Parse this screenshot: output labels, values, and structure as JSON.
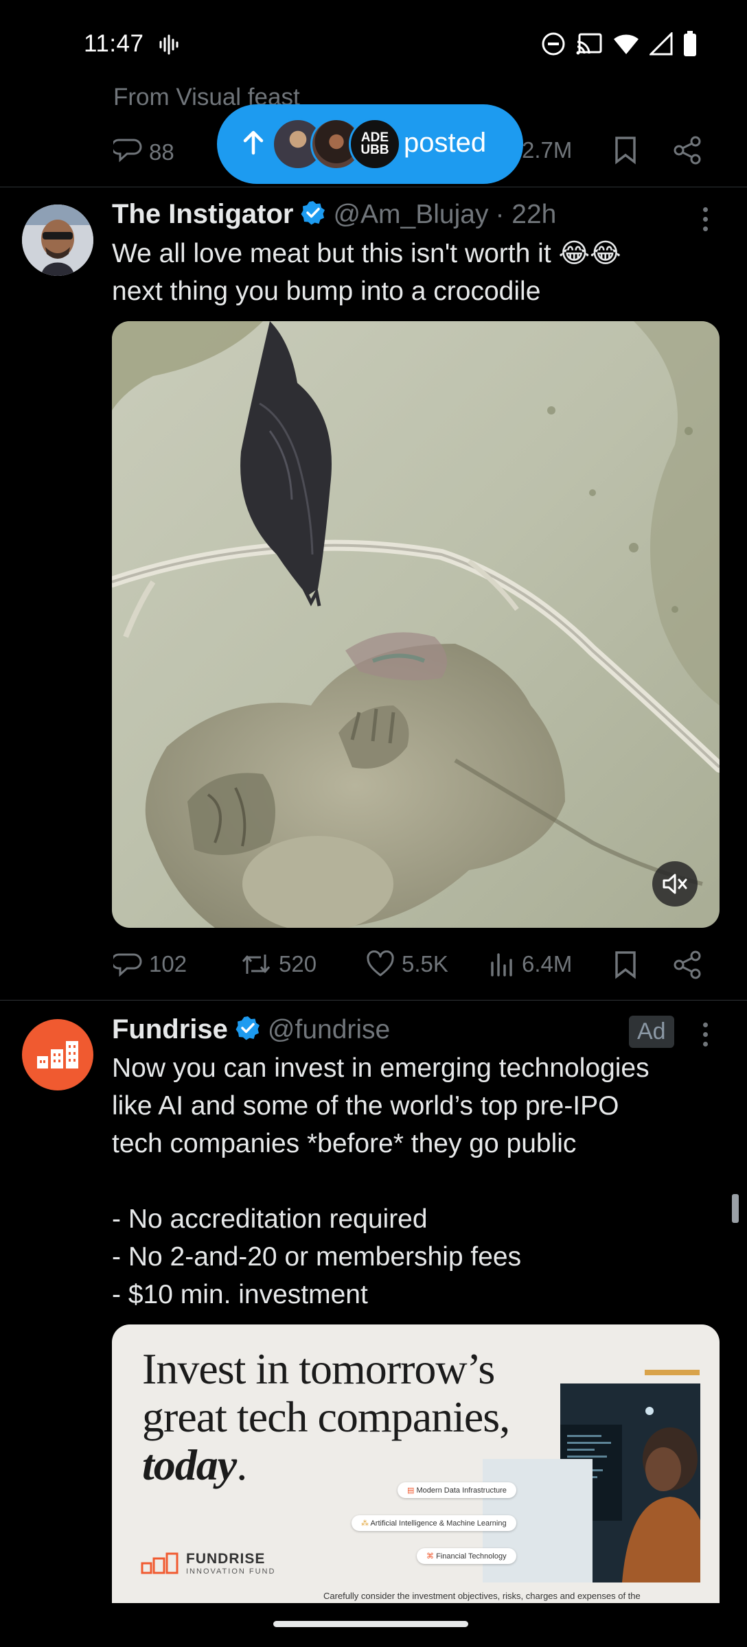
{
  "status_bar": {
    "time": "11:47"
  },
  "top_tweet": {
    "source_text": "From Visual feast",
    "replies": "88",
    "views": "2.7M"
  },
  "posted_pill": {
    "label": "posted",
    "avatar2_text": "ADE\nUBB"
  },
  "tweets": [
    {
      "name": "The Instigator",
      "handle": "@Am_Blujay",
      "time": "· 22h",
      "text_line1": "We all love meat but this isn't worth it 😂😂",
      "text_line2": "next thing you bump into a crocodile",
      "replies": "102",
      "retweets": "520",
      "likes": "5.5K",
      "views": "6.4M"
    },
    {
      "name": "Fundrise",
      "handle": "@fundrise",
      "ad_label": "Ad",
      "text_lines": [
        "Now you can invest in emerging technologies",
        "like AI and some of the world’s top pre-IPO",
        "tech companies *before* they go public",
        "",
        "- No accreditation required",
        "- No 2-and-20 or membership fees",
        "- $10 min. investment"
      ],
      "ad_image": {
        "headline_1": "Invest in tomorrow’s",
        "headline_2": "great tech companies,",
        "headline_3": "today",
        "headline_3_punct": ".",
        "tags": [
          "Modern Data Infrastructure",
          "Artificial Intelligence & Machine Learning",
          "Financial Technology"
        ],
        "brand": "FUNDRISE",
        "brand_sub": "INNOVATION FUND",
        "disclaimer": "Carefully consider the investment objectives, risks, charges and expenses of the"
      }
    }
  ],
  "colors": {
    "accent": "#1d9bf0",
    "text": "#e7e9ea",
    "muted": "#71767b",
    "fundrise": "#f05a30"
  }
}
